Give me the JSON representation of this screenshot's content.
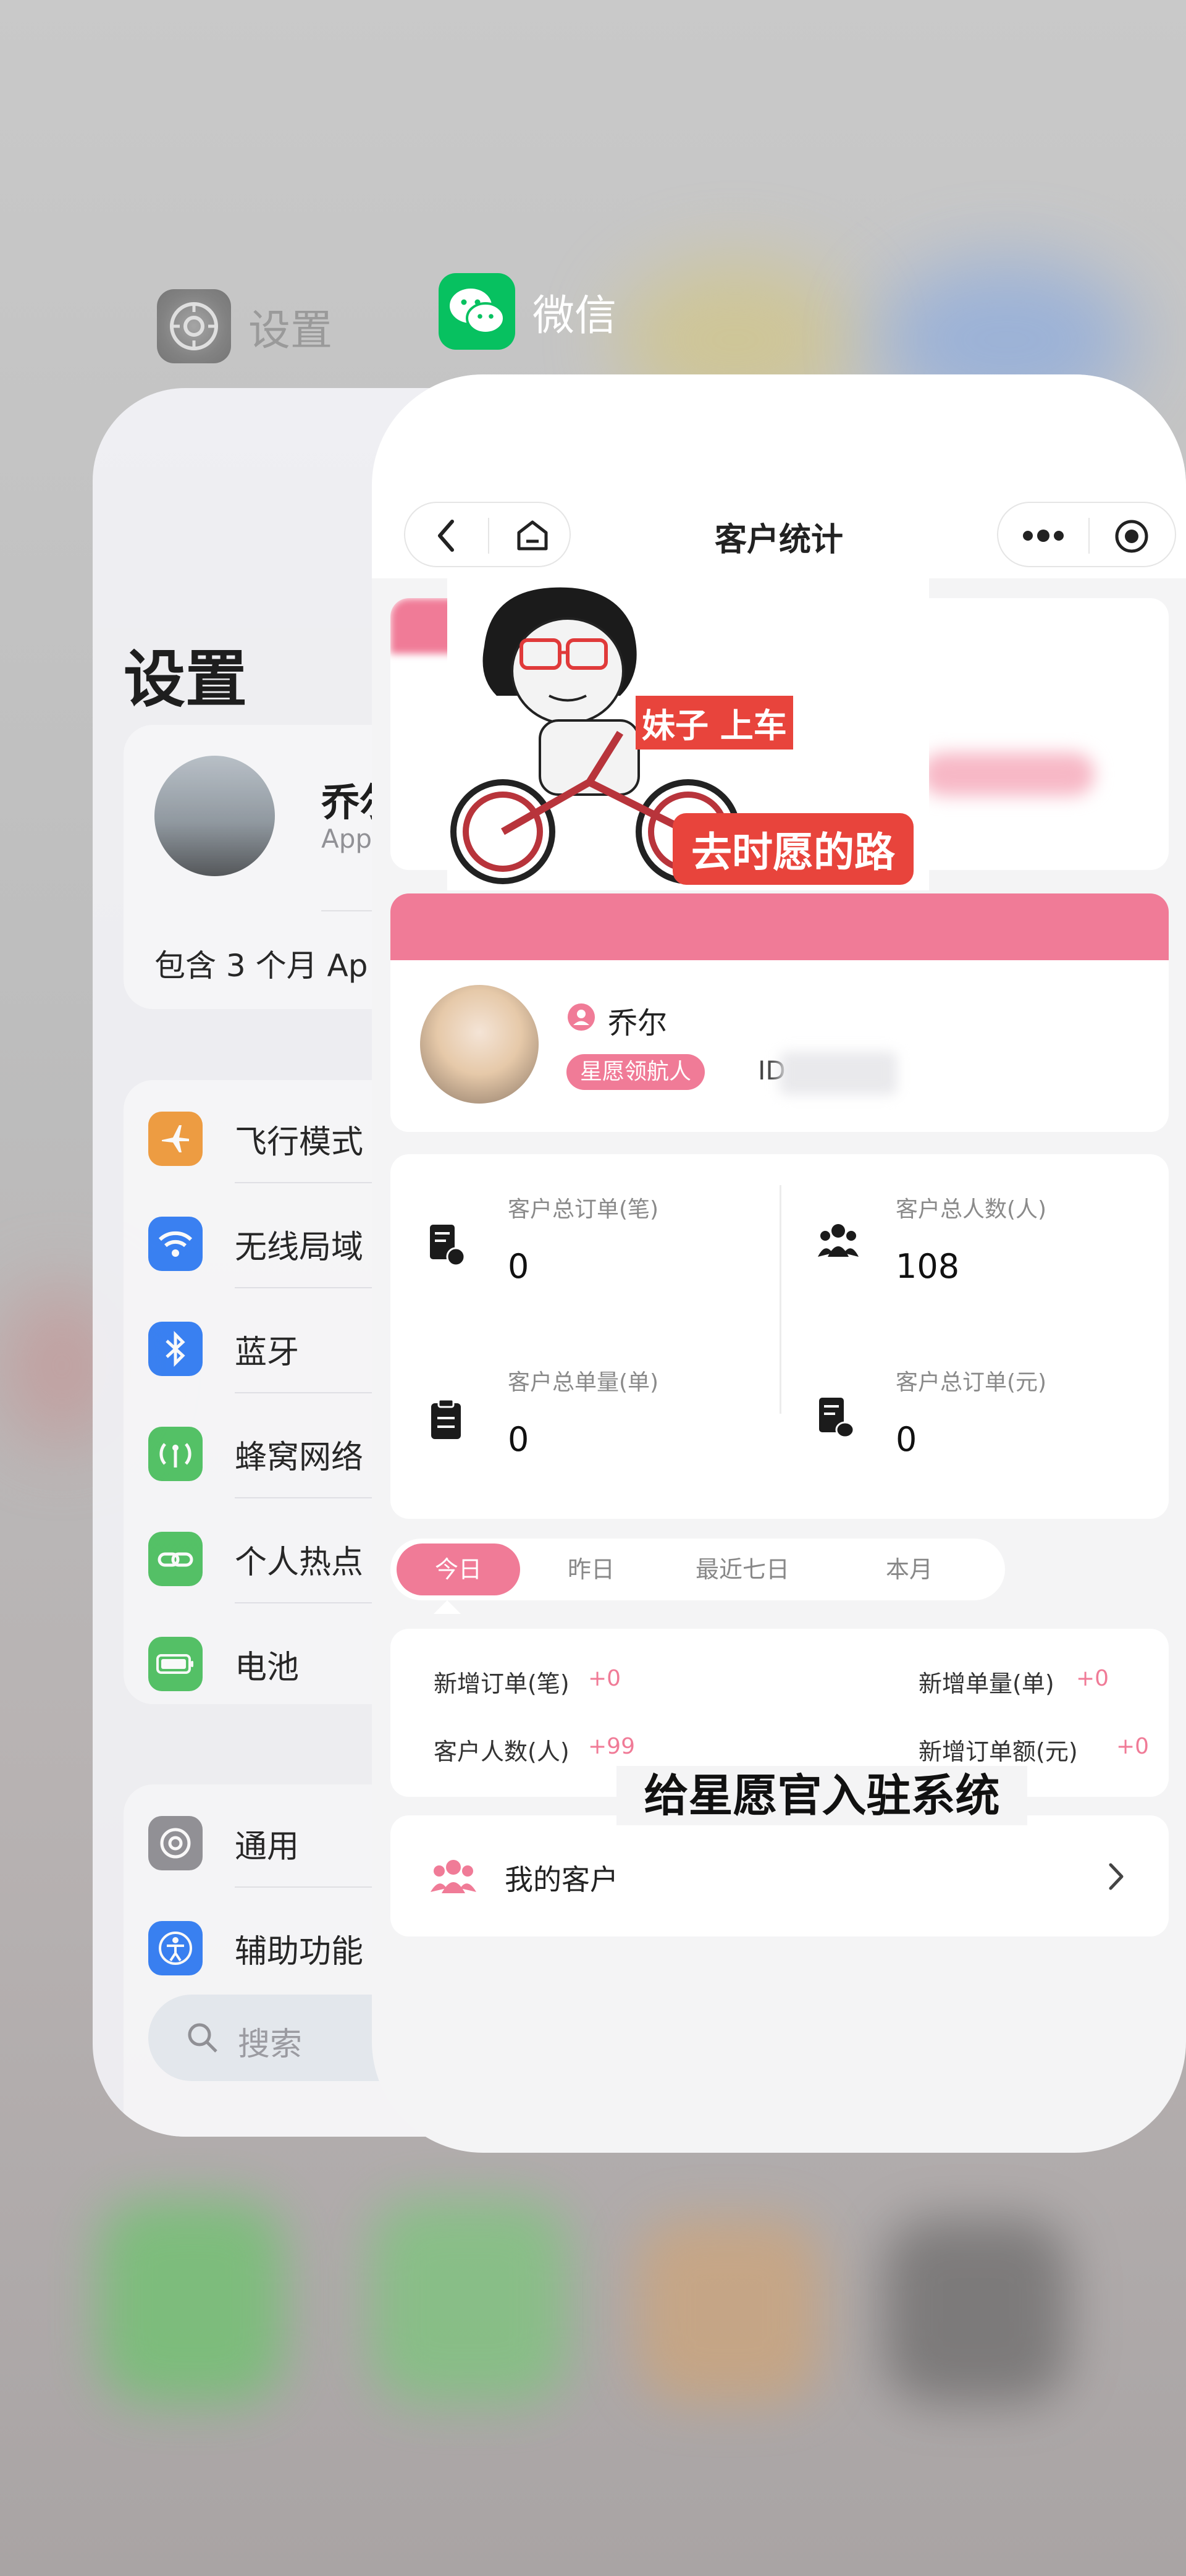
{
  "app_switcher": {
    "settings_label": "设置",
    "wechat_label": "微信",
    "settings_icon": "gear-icon",
    "wechat_icon": "wechat-icon"
  },
  "settings_app": {
    "title": "设置",
    "account": {
      "name": "乔尔",
      "subtitle": "Apple",
      "plan_text": "包含 3 个月 Ap"
    },
    "items": [
      {
        "label": "飞行模式",
        "icon": "airplane-icon",
        "color": "#f29a38"
      },
      {
        "label": "无线局域",
        "icon": "wifi-icon",
        "color": "#2f7cf6"
      },
      {
        "label": "蓝牙",
        "icon": "bluetooth-icon",
        "color": "#2f7cf6"
      },
      {
        "label": "蜂窝网络",
        "icon": "cellular-icon",
        "color": "#4cc260"
      },
      {
        "label": "个人热点",
        "icon": "hotspot-icon",
        "color": "#4cc260"
      },
      {
        "label": "电池",
        "icon": "battery-icon",
        "color": "#4cc260"
      }
    ],
    "items2": [
      {
        "label": "通用",
        "icon": "gear-icon",
        "color": "#8e8e93"
      },
      {
        "label": "辅助功能",
        "icon": "accessibility-icon",
        "color": "#2f7cf6"
      }
    ],
    "search_placeholder": "搜索"
  },
  "miniprogram": {
    "nav_title": "客户统计",
    "sticker": {
      "caption_top": "妹子 上车",
      "caption_bottom": "去时愿的路"
    },
    "profile": {
      "name": "乔尔",
      "role": "星愿领航人",
      "id_prefix": "ID"
    },
    "stats": [
      {
        "label": "客户总订单(笔)",
        "value": "0",
        "icon": "order-doc-icon"
      },
      {
        "label": "客户总人数(人)",
        "value": "108",
        "icon": "users-icon"
      },
      {
        "label": "客户总单量(单)",
        "value": "0",
        "icon": "clipboard-icon"
      },
      {
        "label": "客户总订单(元)",
        "value": "0",
        "icon": "money-doc-icon"
      }
    ],
    "tabs": [
      "今日",
      "昨日",
      "最近七日",
      "本月"
    ],
    "active_tab": "今日",
    "summary": [
      {
        "label": "新增订单(笔)",
        "value": "+0"
      },
      {
        "label": "新增单量(单)",
        "value": "+0"
      },
      {
        "label": "客户人数(人)",
        "value": "+99"
      },
      {
        "label": "新增订单额(元)",
        "value": "+0"
      }
    ],
    "overlay_caption": "给星愿官入驻系统",
    "menu": {
      "my_customers": "我的客户"
    },
    "accent_color": "#f07b97"
  }
}
